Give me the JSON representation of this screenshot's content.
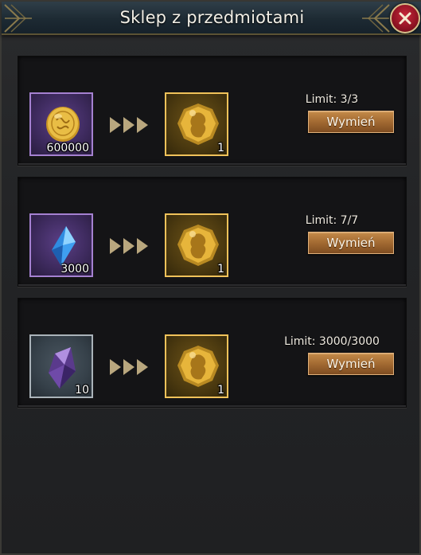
{
  "window": {
    "title": "Sklep z przedmiotami",
    "close_icon": "close-x-icon"
  },
  "colors": {
    "accent_gold": "#f0c25a",
    "button_orange": "#a26a32",
    "close_red": "#8f1323"
  },
  "offers": [
    {
      "cost": {
        "icon": "gold-coin-icon",
        "quantity": "600000"
      },
      "reward": {
        "icon": "ancient-gold-medal-icon",
        "quantity": "1"
      },
      "limit": "Limit: 3/3",
      "button": "Wymień"
    },
    {
      "cost": {
        "icon": "blue-crystal-icon",
        "quantity": "3000"
      },
      "reward": {
        "icon": "ancient-gold-medal-icon",
        "quantity": "1"
      },
      "limit": "Limit: 7/7",
      "button": "Wymień"
    },
    {
      "cost": {
        "icon": "purple-crystal-icon",
        "quantity": "10"
      },
      "reward": {
        "icon": "ancient-gold-medal-icon",
        "quantity": "1"
      },
      "limit": "Limit: 3000/3000",
      "button": "Wymień"
    }
  ]
}
